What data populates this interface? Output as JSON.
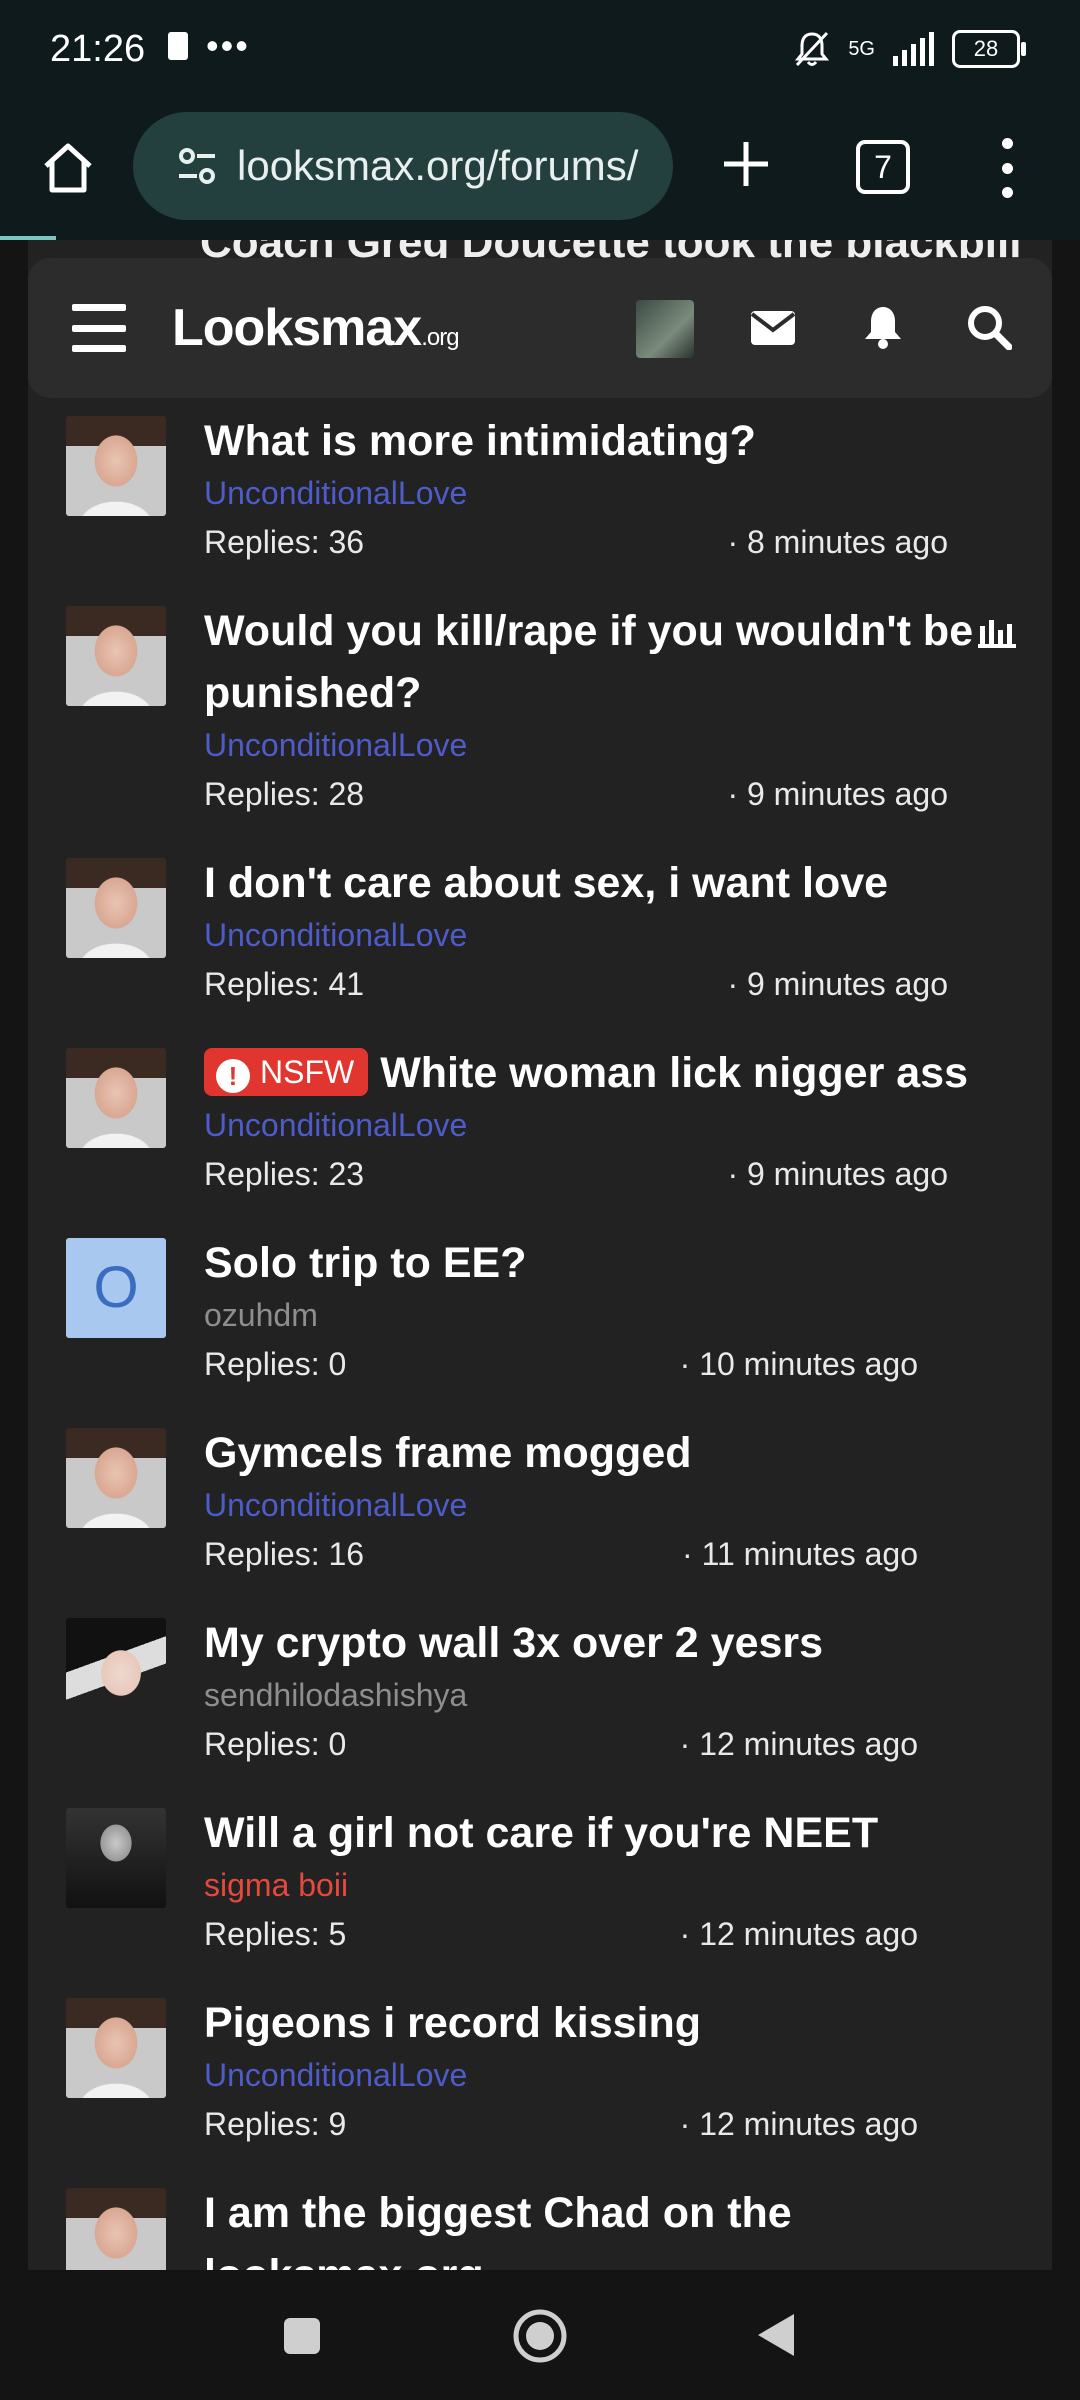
{
  "status_bar": {
    "time": "21:26",
    "network": "5G",
    "battery": "28"
  },
  "browser": {
    "url": "looksmax.org/forums/",
    "tab_count": "7"
  },
  "site": {
    "logo_main": "Looksmax",
    "logo_suffix": ".org",
    "peek_title": "Coach Greg Doucette took the blackpill"
  },
  "threads": [
    {
      "title": "What is more intimidating?",
      "author": "UnconditionalLove",
      "author_style": "blue",
      "replies": "Replies: 36",
      "time": "· 8 minutes ago",
      "avatar": "face"
    },
    {
      "title": "Would you kill/rape if you wouldn't be punished?",
      "author": "UnconditionalLove",
      "author_style": "blue",
      "replies": "Replies: 28",
      "time": "· 9 minutes ago",
      "avatar": "face",
      "has_poll": true
    },
    {
      "title": "I don't care about sex, i want love",
      "author": "UnconditionalLove",
      "author_style": "blue",
      "replies": "Replies: 41",
      "time": "· 9 minutes ago",
      "avatar": "face"
    },
    {
      "title": "White woman lick nigger ass",
      "badge": "NSFW",
      "author": "UnconditionalLove",
      "author_style": "blue",
      "replies": "Replies: 23",
      "time": "· 9 minutes ago",
      "avatar": "face"
    },
    {
      "title": "Solo trip to EE?",
      "author": "ozuhdm",
      "author_style": "gray",
      "replies": "Replies: 0",
      "time": "· 10 minutes ago",
      "avatar": "letter",
      "avatar_letter": "O"
    },
    {
      "title": "Gymcels frame mogged",
      "author": "UnconditionalLove",
      "author_style": "blue",
      "replies": "Replies: 16",
      "time": "· 11 minutes ago",
      "avatar": "face"
    },
    {
      "title": "My crypto wall 3x over 2 yesrs",
      "author": "sendhilodashishya",
      "author_style": "gray",
      "replies": "Replies: 0",
      "time": "· 12 minutes ago",
      "avatar": "girl"
    },
    {
      "title": "Will a girl not care if you're NEET",
      "author": "sigma boii",
      "author_style": "red",
      "replies": "Replies: 5",
      "time": "· 12 minutes ago",
      "avatar": "dark"
    },
    {
      "title": "Pigeons i record kissing",
      "author": "UnconditionalLove",
      "author_style": "blue",
      "replies": "Replies: 9",
      "time": "· 12 minutes ago",
      "avatar": "face"
    },
    {
      "title": "I am the biggest Chad on the looksmax.org",
      "author": "UnconditionalLove",
      "author_style": "blue",
      "replies": "",
      "time": "",
      "avatar": "face"
    }
  ],
  "colors": {
    "author_blue": "#4d5cc8",
    "author_red": "#e5483c",
    "nsfw_badge": "#e0362f",
    "url_bar": "#23403f"
  }
}
